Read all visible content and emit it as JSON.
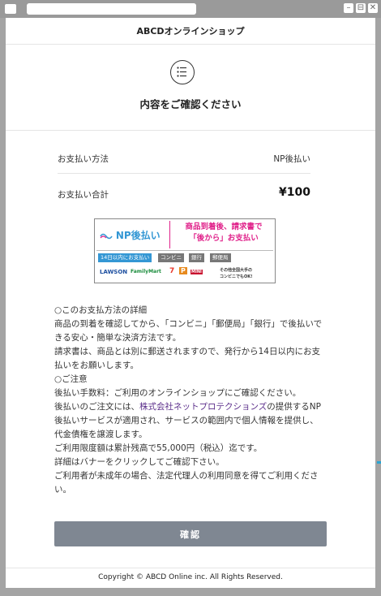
{
  "window": {
    "restore_glyph": "⊟",
    "close_glyph": "✕",
    "minimize_glyph": "–"
  },
  "header": {
    "title": "ABCDオンラインショップ"
  },
  "confirm_section": {
    "icon": "checklist-icon",
    "title": "内容をご確認ください"
  },
  "summary": {
    "method_label": "お支払い方法",
    "method_value": "NP後払い",
    "total_label": "お支払い合計",
    "total_value": "¥100"
  },
  "banner": {
    "logo_text": "NP後払い",
    "headline_line1": "商品到着後、請求書で",
    "headline_line2": "「後から」お支払い",
    "tags": [
      "14日以内にお支払い",
      "コンビニ",
      "銀行",
      "郵便局"
    ],
    "stores": [
      "LAWSON",
      "FamilyMart",
      "7",
      "P",
      "MINI",
      "その他全国大手の",
      "コンビニでもOK!"
    ]
  },
  "body": {
    "lines": [
      "○このお支払方法の詳細",
      "商品の到着を確認してから、「コンビニ」「郵便局」「銀行」で後払いできる安心・簡単な決済方法です。",
      "請求書は、商品とは別に郵送されますので、発行から14日以内にお支払いをお願いします。",
      "○ご注意",
      "後払い手数料：ご利用のオンラインショップにご確認ください。"
    ],
    "notice_prefix": "後払いのご注文には、",
    "notice_link": "株式会社ネットプロテクションズ",
    "notice_suffix": "の提供するNP後払いサービスが適用され、サービスの範囲内で個人情報を提供し、代金債権を譲渡します。",
    "lines2": [
      "ご利用限度額は累計残高で55,000円（税込）迄です。",
      "詳細はバナーをクリックしてご確認下さい。",
      "ご利用者が未成年の場合、法定代理人の利用同意を得てご利用ください。"
    ]
  },
  "confirm_button": {
    "label": "確認"
  },
  "footer": {
    "copyright": "Copyright © ABCD Online inc. All Rights Reserved."
  },
  "colors": {
    "accent_pink": "#e0218a",
    "np_blue": "#3497d4",
    "button_gray": "#7f8792",
    "link_purple": "#5a2d8a"
  }
}
